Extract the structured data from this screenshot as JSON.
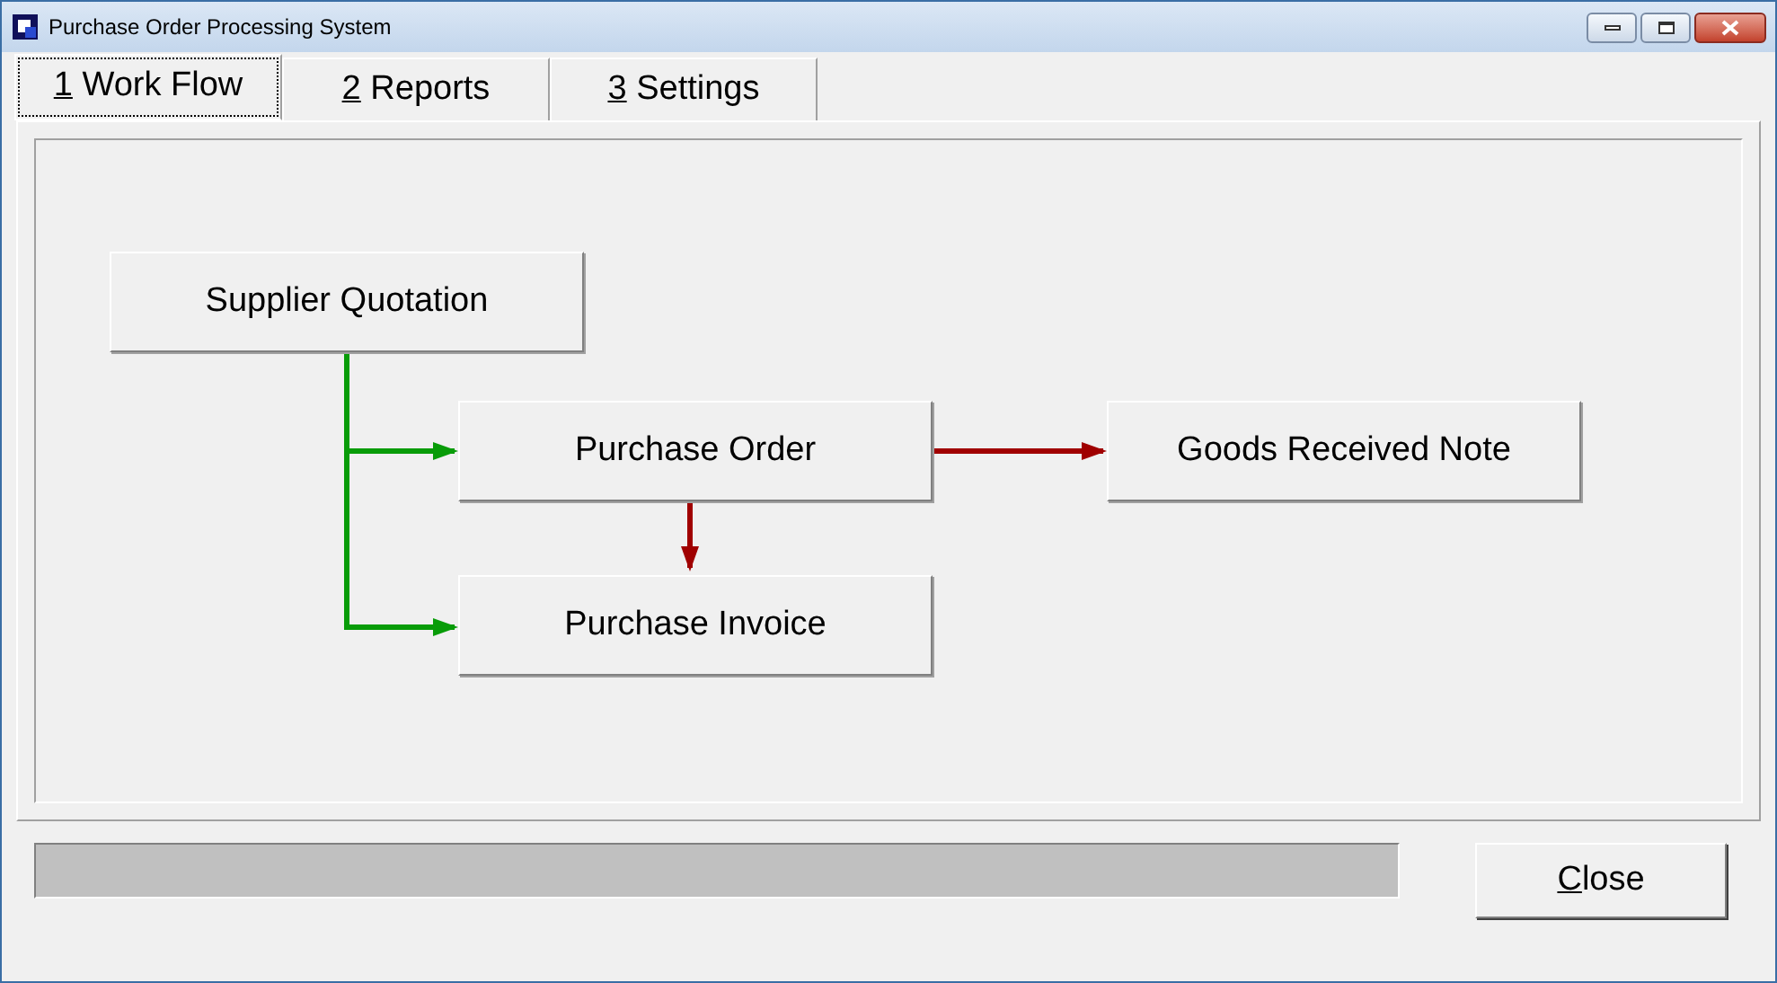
{
  "window": {
    "title": "Purchase Order Processing System"
  },
  "tabs": [
    {
      "key": "1",
      "label": " Work Flow",
      "selected": true
    },
    {
      "key": "2",
      "label": " Reports",
      "selected": false
    },
    {
      "key": "3",
      "label": " Settings",
      "selected": false
    }
  ],
  "workflow": {
    "nodes": [
      {
        "label": "Supplier Quotation"
      },
      {
        "label": "Purchase Order"
      },
      {
        "label": "Purchase Invoice"
      },
      {
        "label": "Goods Received Note"
      }
    ],
    "edges": [
      {
        "color": "#089c08"
      },
      {
        "color": "#089c08"
      },
      {
        "color": "#a00000"
      },
      {
        "color": "#a00000"
      }
    ]
  },
  "progress": {
    "level": 0
  },
  "close_button": {
    "key": "C",
    "label": "lose"
  }
}
